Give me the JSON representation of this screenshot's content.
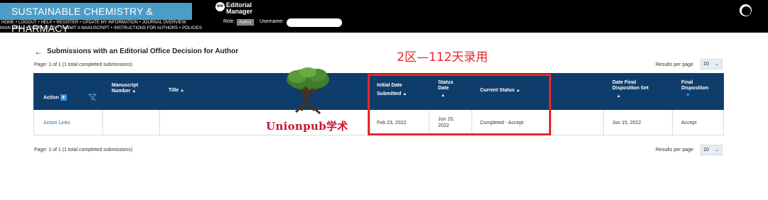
{
  "header": {
    "journal_title": "SUSTAINABLE CHEMISTRY & PHARMACY",
    "em_badge": "em",
    "em_line1": "Editorial",
    "em_line2": "Manager",
    "nav_row1": [
      "HOME",
      "LOGOUT",
      "HELP",
      "REGISTER",
      "UPDATE MY INFORMATION",
      "JOURNAL OVERVIEW"
    ],
    "nav_row2": [
      "MAIN MENU",
      "CONTACT US",
      "SUBMIT A MANUSCRIPT",
      "INSTRUCTIONS FOR AUTHORS",
      "POLICIES"
    ],
    "role_label": "Role:",
    "role_value": "Author",
    "username_label": "Username:"
  },
  "page": {
    "title": "Submissions with an Editorial Office Decision for Author",
    "page_info_top": "Page: 1 of 1 (1 total completed submissions)",
    "page_info_bottom": "Page: 1 of 1 (1 total completed submissions)",
    "results_per_page_label": "Results per page",
    "results_per_page_value": "10"
  },
  "overlay": {
    "note": "2区—112天录用",
    "watermark": "Unionpub学术"
  },
  "table": {
    "headers": {
      "action": "Action",
      "manuscript_number_1": "Manuscript",
      "manuscript_number_2": "Number",
      "title": "Title",
      "initial_date_1": "Initial Date",
      "initial_date_2": "Submitted",
      "status_date_1": "Status",
      "status_date_2": "Date",
      "current_status": "Current Status",
      "date_final_1": "Date Final",
      "date_final_2": "Disposition Set",
      "final_disp_1": "Final",
      "final_disp_2": "Disposition"
    },
    "rows": [
      {
        "action": "Action Links",
        "manuscript_number": "",
        "title": "",
        "initial_date": "Feb 23, 2022",
        "status_date_1": "Jun 15,",
        "status_date_2": "2022",
        "current_status": "Completed - Accept",
        "date_final": "Jun 15, 2022",
        "final_disposition": "Accept"
      }
    ]
  },
  "colors": {
    "header_bg": "#000000",
    "journal_bar": "#4d9cc7",
    "table_header": "#0f3d6b",
    "highlight": "#e8262a",
    "link": "#1f6fb3"
  }
}
